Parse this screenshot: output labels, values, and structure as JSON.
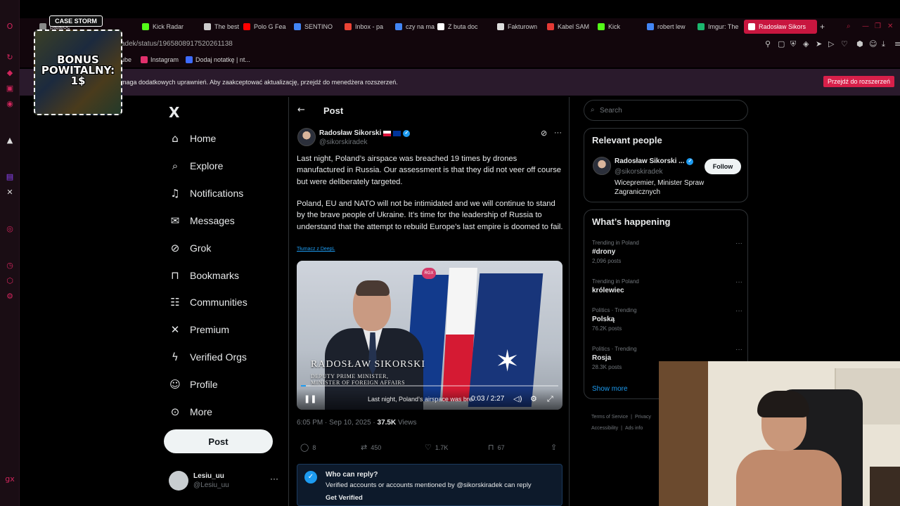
{
  "browser": {
    "tabs": [
      {
        "label": "pajaloc",
        "color": "#888"
      },
      {
        "label": "Kick Radar",
        "color": "#53fc18"
      },
      {
        "label": "The best C",
        "color": "#ccc"
      },
      {
        "label": "Polo G Fea",
        "color": "#ff0000"
      },
      {
        "label": "SENTINO",
        "color": "#4285f4"
      },
      {
        "label": "Inbox - pa",
        "color": "#ea4335"
      },
      {
        "label": "czy na mał",
        "color": "#4285f4"
      },
      {
        "label": "Z buta doc",
        "color": "#ffffff"
      },
      {
        "label": "Fakturown",
        "color": "#dddddd"
      },
      {
        "label": "Kabel SAM",
        "color": "#e53935"
      },
      {
        "label": "Kick",
        "color": "#53fc18"
      },
      {
        "label": "robert lew",
        "color": "#4285f4"
      },
      {
        "label": "Imgur: The",
        "color": "#1bb76e"
      },
      {
        "label": "Radosław Sikors",
        "color": "#ffffff",
        "active": true
      }
    ],
    "url": "adek/status/1965808917520261138",
    "bookmarks": [
      {
        "label": "ube",
        "color": "#ff0000"
      },
      {
        "label": "Instagram",
        "color": "#e1306c"
      },
      {
        "label": "Dodaj notatkę | nt...",
        "color": "#3d6bff"
      }
    ],
    "infobar": {
      "text": "maga dodatkowych uprawnień. Aby zaakceptować aktualizację, przejdź do menedżera rozszerzeń.",
      "button": "Przejdź do rozszerzeń"
    },
    "accent_color": "#d8204a"
  },
  "promo": {
    "logo": "CASE STORM",
    "title_line1": "BONUS",
    "title_line2": "POWITALNY:",
    "title_line3": "1$"
  },
  "nav": {
    "logo": "X",
    "items": [
      {
        "label": "Home",
        "icon": "home-icon"
      },
      {
        "label": "Explore",
        "icon": "search-icon"
      },
      {
        "label": "Notifications",
        "icon": "bell-icon"
      },
      {
        "label": "Messages",
        "icon": "mail-icon"
      },
      {
        "label": "Grok",
        "icon": "grok-icon"
      },
      {
        "label": "Bookmarks",
        "icon": "bookmark-icon"
      },
      {
        "label": "Communities",
        "icon": "people-icon"
      },
      {
        "label": "Premium",
        "icon": "x-icon"
      },
      {
        "label": "Verified Orgs",
        "icon": "lightning-icon"
      },
      {
        "label": "Profile",
        "icon": "person-icon"
      },
      {
        "label": "More",
        "icon": "more-circle-icon"
      }
    ],
    "post_button": "Post",
    "account": {
      "name": "Lesiu_uu",
      "handle": "@Lesiu_uu"
    }
  },
  "post": {
    "header": "Post",
    "author": {
      "name": "Radosław Sikorski",
      "handle": "@sikorskiradek"
    },
    "text_p1": "Last night, Poland’s airspace was breached 19 times by drones manufactured in Russia. Our assessment is that they did not veer off course but were deliberately targeted.",
    "text_p2": "Poland, EU and NATO will not be intimidated and we will continue to stand by the brave people of Ukraine.  It’s time for the leadership of Russia to understand that the attempt to rebuild Europe’s last empire is doomed to fail.",
    "translate": "Tłumacz z DeepL",
    "video": {
      "badge": "RGX",
      "name_overlay": "RADOSŁAW SIKORSKI",
      "role_line1": "DEPUTY PRIME MINISTER,",
      "role_line2": "MINISTER OF FOREIGN AFFAIRS",
      "caption": "Last night, Poland’s airspace was breached",
      "time": "0:03 / 2:27",
      "progress_fraction": 0.02
    },
    "meta": {
      "datetime": "6:05 PM · Sep 10, 2025 · ",
      "views": "37.5K",
      "views_label": " Views"
    },
    "actions": {
      "replies": "8",
      "reposts": "450",
      "likes": "1.7K",
      "bookmarks": "67"
    },
    "reply_box": {
      "title": "Who can reply?",
      "desc": "Verified accounts or accounts mentioned by @sikorskiradek can reply",
      "link": "Get Verified"
    }
  },
  "sidebar": {
    "search_placeholder": "Search",
    "relevant": {
      "title": "Relevant people",
      "name": "Radosław Sikorski ...",
      "handle": "@sikorskiradek",
      "bio": "Wicepremier, Minister Spraw Zagranicznych",
      "follow": "Follow"
    },
    "happening": {
      "title": "What’s happening",
      "trends": [
        {
          "meta": "Trending in Poland",
          "title": "#drony",
          "count": "2,096 posts"
        },
        {
          "meta": "Trending in Poland",
          "title": "królewiec",
          "count": ""
        },
        {
          "meta": "Politics · Trending",
          "title": "Polską",
          "count": "76.2K posts"
        },
        {
          "meta": "Politics · Trending",
          "title": "Rosja",
          "count": "28.3K posts"
        }
      ],
      "show_more": "Show more"
    },
    "footer": {
      "terms": "Terms of Service",
      "privacy": "Privacy",
      "accessibility": "Accessibility",
      "ads": "Ads info"
    }
  }
}
